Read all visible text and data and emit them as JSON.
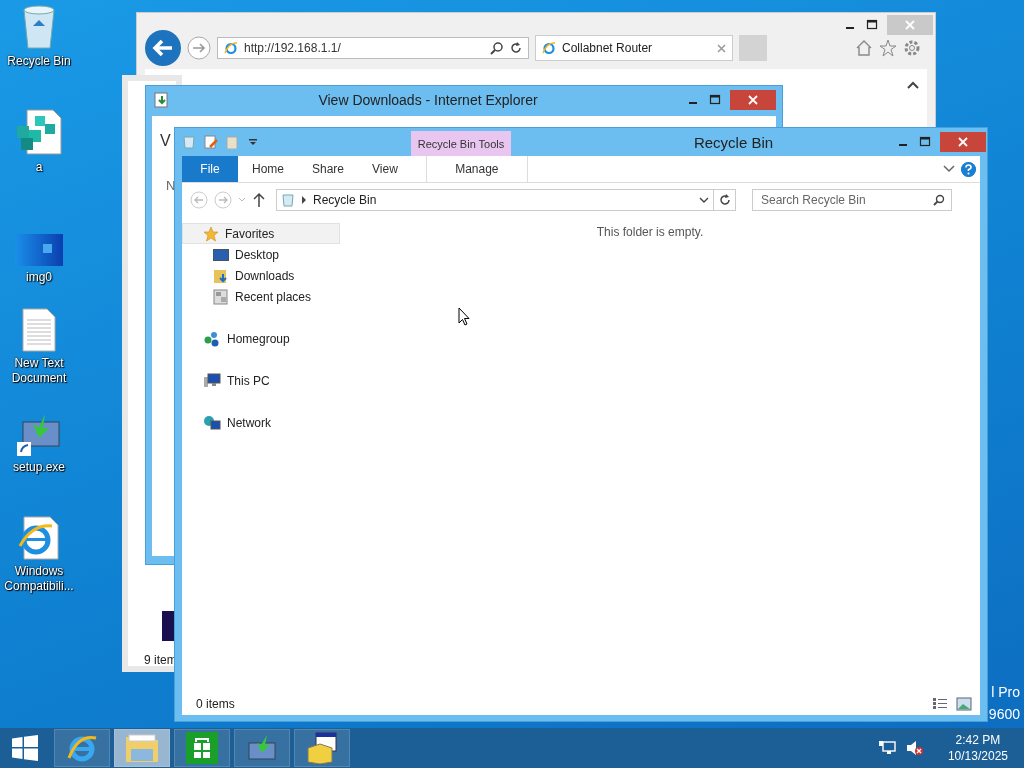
{
  "desktop": {
    "icons": [
      {
        "label": "Recycle Bin",
        "kind": "recycle"
      },
      {
        "label": "a",
        "kind": "registry"
      },
      {
        "label": "img0",
        "kind": "image"
      },
      {
        "label": "New Text Document",
        "kind": "text"
      },
      {
        "label": "setup.exe",
        "kind": "setup"
      },
      {
        "label": "Windows Compatibili...",
        "kind": "iedoc"
      }
    ],
    "edition_fragments": [
      "l Pro",
      "9600"
    ]
  },
  "browser_window": {
    "address": "http://192.168.1.1/",
    "tab": "Collabnet Router"
  },
  "back_window": {
    "status": "9 item"
  },
  "downloads_window": {
    "title": "View Downloads - Internet Explorer",
    "heading_fragment": "V",
    "column_fragment": "N"
  },
  "explorer": {
    "title": "Recycle Bin",
    "context_tab": "Recycle Bin Tools",
    "ribbon_tabs": [
      {
        "label": "File",
        "kind": "menu",
        "selected": false
      },
      {
        "label": "Home",
        "kind": "tab",
        "selected": false
      },
      {
        "label": "Share",
        "kind": "tab",
        "selected": false
      },
      {
        "label": "View",
        "kind": "tab",
        "selected": false
      },
      {
        "label": "Manage",
        "kind": "contextual",
        "selected": false
      }
    ],
    "breadcrumb": "Recycle Bin",
    "search": {
      "placeholder": "Search Recycle Bin"
    },
    "navigation": [
      {
        "label": "Favorites",
        "kind": "star",
        "selected": true,
        "children": [
          {
            "label": "Desktop",
            "kind": "desktop",
            "selected": false
          },
          {
            "label": "Downloads",
            "kind": "downloads",
            "selected": false
          },
          {
            "label": "Recent places",
            "kind": "recent",
            "selected": false
          }
        ]
      },
      {
        "label": "Homegroup",
        "kind": "homegroup",
        "selected": false
      },
      {
        "label": "This PC",
        "kind": "computer",
        "selected": false
      },
      {
        "label": "Network",
        "kind": "network",
        "selected": false
      }
    ],
    "empty_message": "This folder is empty.",
    "status": "0 items"
  },
  "taskbar": {
    "apps": [
      {
        "kind": "browser",
        "selected": false
      },
      {
        "kind": "explorer",
        "selected": true
      },
      {
        "kind": "store",
        "selected": false
      },
      {
        "kind": "setup",
        "selected": false
      },
      {
        "kind": "installer",
        "selected": false
      }
    ],
    "time": "2:42 PM",
    "date": "10/13/2025"
  }
}
